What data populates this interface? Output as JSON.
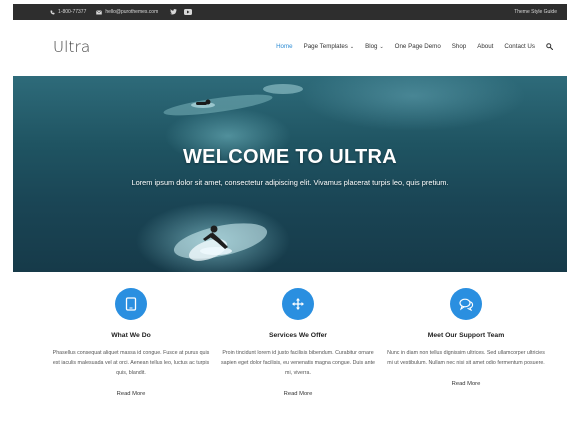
{
  "topbar": {
    "phone": "1-800-77377",
    "email": "hello@purothemes.com",
    "social_icons": [
      "twitter-icon",
      "youtube-icon"
    ],
    "guide_link": "Theme Style Guide"
  },
  "header": {
    "logo": "Ultra",
    "nav": [
      {
        "label": "Home",
        "active": true,
        "dropdown": false
      },
      {
        "label": "Page Templates",
        "active": false,
        "dropdown": true
      },
      {
        "label": "Blog",
        "active": false,
        "dropdown": true
      },
      {
        "label": "One Page Demo",
        "active": false,
        "dropdown": false
      },
      {
        "label": "Shop",
        "active": false,
        "dropdown": false
      },
      {
        "label": "About",
        "active": false,
        "dropdown": false
      },
      {
        "label": "Contact Us",
        "active": false,
        "dropdown": false
      }
    ],
    "caret": "⌄",
    "search_icon": "search-icon"
  },
  "hero": {
    "title": "WELCOME TO ULTRA",
    "subtitle": "Lorem ipsum dolor sit amet, consectetur adipiscing elit. Vivamus placerat turpis leo, quis pretium."
  },
  "features": [
    {
      "icon": "tablet-icon",
      "title": "What We Do",
      "text": "Phasellus consequat aliquet massa id congue. Fusce at purus quis est iaculis malesuada vel at orci. Aenean tellus leo, luctus ac turpis quis, blandit.",
      "more": "Read More"
    },
    {
      "icon": "move-arrows-icon",
      "title": "Services We Offer",
      "text": "Proin tincidunt lorem id justo facilisis bibendum. Curabitur ornare sapien eget dolor facilisis, eu venenatis magna congue. Duis ante mi, viverra.",
      "more": "Read More"
    },
    {
      "icon": "chat-bubbles-icon",
      "title": "Meet Our Support Team",
      "text": "Nunc in diam non tellus dignissim ultrices. Sed ullamcorper ultricies mi ut vestibulum. Nullam nec nisi sit amet odio fermentum posuere.",
      "more": "Read More"
    }
  ],
  "colors": {
    "accent": "#2a8fe0",
    "nav_active": "#2d8cd4",
    "topbar_bg": "#2e2e2e"
  }
}
